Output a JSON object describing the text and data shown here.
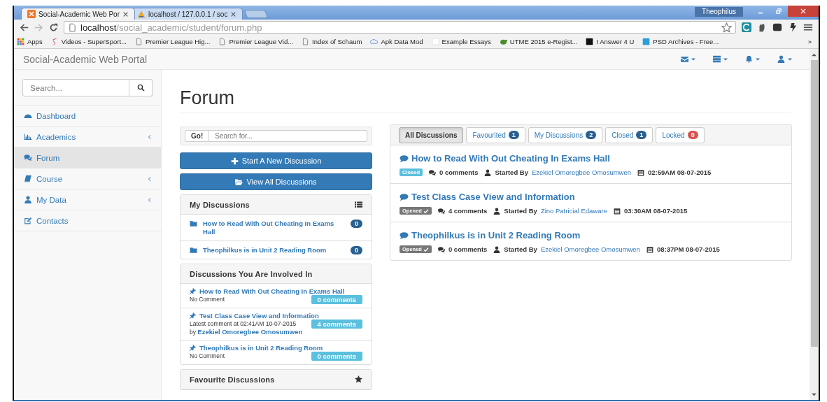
{
  "browser": {
    "tabs": [
      {
        "title": "Social-Academic Web Por",
        "selected": true
      },
      {
        "title": "localhost / 127.0.0.1 / soc",
        "selected": false
      }
    ],
    "user": "Theophilus",
    "address": {
      "host": "localhost",
      "path": "/social_academic/student/forum.php"
    },
    "bookmarks": [
      {
        "label": "Apps"
      },
      {
        "label": "Videos - SuperSport..."
      },
      {
        "label": "Premier League Hig..."
      },
      {
        "label": "Premier League Vid..."
      },
      {
        "label": "Index of Schaum"
      },
      {
        "label": "Apk Data Mod"
      },
      {
        "label": "Example Essays"
      },
      {
        "label": "UTME 2015 e-Regist..."
      },
      {
        "label": "I Answer 4 U"
      },
      {
        "label": "PSD Archives - Free..."
      }
    ],
    "more": "»"
  },
  "site": {
    "brand": "Social-Academic Web Portal"
  },
  "sidebar": {
    "search_placeholder": "Search...",
    "items": [
      {
        "label": "Dashboard",
        "expandable": false,
        "selected": false
      },
      {
        "label": "Academics",
        "expandable": true,
        "selected": false
      },
      {
        "label": "Forum",
        "expandable": false,
        "selected": true
      },
      {
        "label": "Course",
        "expandable": true,
        "selected": false
      },
      {
        "label": "My Data",
        "expandable": true,
        "selected": false
      },
      {
        "label": "Contacts",
        "expandable": false,
        "selected": false
      }
    ]
  },
  "page_title": "Forum",
  "search": {
    "button": "Go!",
    "placeholder": "Search for..."
  },
  "actions": [
    {
      "label": "Start A New Discussion"
    },
    {
      "label": "View All Discussions"
    }
  ],
  "my_discussions": {
    "title": "My Discussions",
    "items": [
      {
        "title": "How to Read With Out Cheating In Exams Hall",
        "count": "0"
      },
      {
        "title": "Theophilkus is in Unit 2 Reading Room",
        "count": "0"
      }
    ]
  },
  "involved": {
    "title": "Discussions You Are Involved In",
    "items": [
      {
        "title": "How to Read With Out Cheating In Exams Hall",
        "comment": "No Comment",
        "count": "0 comments"
      },
      {
        "title": "Test Class Case View and Information",
        "comment": "Latest comment at 02:41AM 10-07-2015",
        "by": "by",
        "author": "Ezekiel Omoregbee Omosumwen",
        "count": "4 comments"
      },
      {
        "title": "Theophilkus is in Unit 2 Reading Room",
        "comment": "No Comment",
        "count": "0 comments"
      }
    ]
  },
  "favourites": {
    "title": "Favourite Discussions"
  },
  "filter_tabs": [
    {
      "label": "All Discussions",
      "selected": true
    },
    {
      "label": "Favourited",
      "count": "1",
      "color": "#2a5f91",
      "selected": false
    },
    {
      "label": "My Discussions",
      "count": "2",
      "color": "#2a5f91",
      "selected": false
    },
    {
      "label": "Closed",
      "count": "1",
      "color": "#2a5f91",
      "selected": false
    },
    {
      "label": "Locked",
      "count": "0",
      "color": "#d9534f",
      "selected": false
    }
  ],
  "discussions": [
    {
      "title": "How to Read With Out Cheating In Exams Hall",
      "kind": "closed",
      "status": "Closed",
      "comments": "0 comments",
      "started_label": "Started By",
      "author": "Ezekiel Omoregbee Omosumwen",
      "time": "02:59AM 08-07-2015"
    },
    {
      "title": "Test Class Case View and Information",
      "kind": "opened",
      "status": "Opened",
      "comments": "4 comments",
      "started_label": "Started By",
      "author": "Zino Patricial Edaware",
      "time": "03:30AM 08-07-2015"
    },
    {
      "title": "Theophilkus is in Unit 2 Reading Room",
      "kind": "opened",
      "status": "Opened",
      "comments": "0 comments",
      "started_label": "Started By",
      "author": "Ezekiel Omoregbee Omosumwen",
      "time": "08:37PM 08-07-2015"
    }
  ]
}
